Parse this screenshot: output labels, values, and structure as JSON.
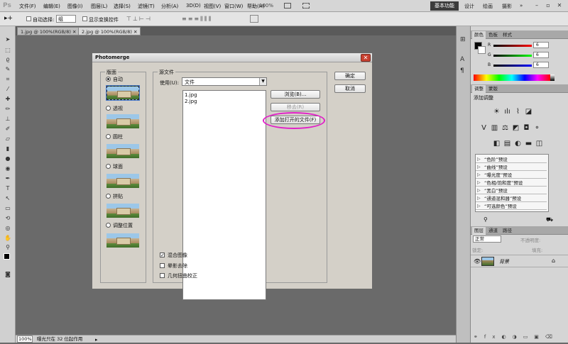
{
  "app": {
    "logo": "Ps"
  },
  "menu": [
    "文件(F)",
    "编辑(E)",
    "图像(I)",
    "图层(L)",
    "选择(S)",
    "滤镜(T)",
    "分析(A)",
    "3D(D)",
    "视图(V)",
    "窗口(W)",
    "帮助(H)"
  ],
  "menubar_zoom": "100%",
  "workspaces": {
    "active": "基本功能",
    "others": [
      "设计",
      "绘画",
      "摄影"
    ],
    "more": "»"
  },
  "options_bar": {
    "auto_select_label": "自动选择:",
    "auto_select_value": "组",
    "show_transform_label": "显示变换控件"
  },
  "doc_tabs": [
    "1.jpg @ 100%(RGB/8)",
    "2.jpg @ 100%(RGB/8)"
  ],
  "status": {
    "zoom": "100%",
    "message": "曝光只在 32 位起作用"
  },
  "dialog": {
    "title": "Photomerge",
    "close": "✕",
    "layout_label": "版面",
    "layouts": [
      {
        "label": "自动",
        "selected": true
      },
      {
        "label": "透视",
        "selected": false
      },
      {
        "label": "圆柱",
        "selected": false
      },
      {
        "label": "球面",
        "selected": false
      },
      {
        "label": "拼贴",
        "selected": false
      },
      {
        "label": "调整位置",
        "selected": false
      }
    ],
    "source_label": "源文件",
    "use_label": "使用(U):",
    "use_value": "文件",
    "files": [
      "1.jpg",
      "2.jpg"
    ],
    "browse_button": "浏览(B)...",
    "remove_button": "移去(R)",
    "add_open_button": "添加打开的文件(F)",
    "ok_button": "确定",
    "cancel_button": "取消",
    "options": [
      {
        "label": "混合图像",
        "checked": true
      },
      {
        "label": "晕影去除",
        "checked": false
      },
      {
        "label": "几何扭曲校正",
        "checked": false
      }
    ]
  },
  "color_panel": {
    "tabs": [
      "颜色",
      "色板",
      "样式"
    ],
    "channels": [
      {
        "name": "R",
        "value": "6",
        "color": "#d02020"
      },
      {
        "name": "G",
        "value": "6",
        "color": "#20a020"
      },
      {
        "name": "B",
        "value": "6",
        "color": "#2030d0"
      }
    ]
  },
  "adjust_panel": {
    "tabs": [
      "调整",
      "蒙版"
    ],
    "heading": "添加调整",
    "presets": [
      "“色阶”预设",
      "“曲线”预设",
      "“曝光度”预设",
      "“色相/饱和度”预设",
      "“黑白”预设",
      "“通道混和器”预设",
      "“可选颜色”预设"
    ]
  },
  "layers_panel": {
    "tabs": [
      "图层",
      "通道",
      "路径"
    ],
    "blend_mode": "正常",
    "opacity_label": "不透明度:",
    "lock_label": "锁定:",
    "fill_label": "填充:",
    "layer_name": "背景"
  },
  "colors": {
    "accent": "#e020c8",
    "menubar": "#d6d6d6",
    "canvas": "#6a6a6a"
  }
}
